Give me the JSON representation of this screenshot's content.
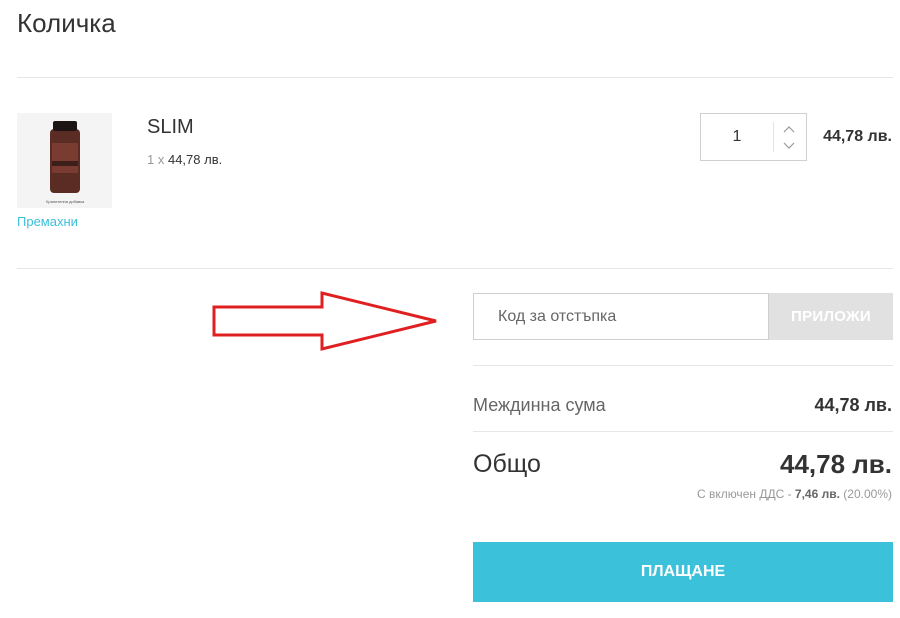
{
  "header": {
    "title": "Количка"
  },
  "cart_item": {
    "name": "SLIM",
    "quantity_prefix": "1 x",
    "unit_price": "44,78 лв.",
    "quantity": "1",
    "line_total": "44,78 лв.",
    "remove_label": "Премахни",
    "thumb_caption": "Хранителна добавка"
  },
  "coupon": {
    "placeholder": "Код за отстъпка",
    "apply_label": "ПРИЛОЖИ"
  },
  "summary": {
    "subtotal_label": "Междинна сума",
    "subtotal_value": "44,78 лв.",
    "total_label": "Общо",
    "total_value": "44,78 лв.",
    "vat_prefix": "С включен ДДС -",
    "vat_amount": "7,46 лв.",
    "vat_rate": "(20.00%)"
  },
  "checkout": {
    "label": "ПЛАЩАНЕ"
  },
  "colors": {
    "accent": "#3bc1d9",
    "arrow": "#e02020",
    "apply_button": "#e1e1e1"
  },
  "icons": {
    "qty_up": "chevron-up-icon",
    "qty_down": "chevron-down-icon",
    "pointer": "arrow-right-icon"
  }
}
